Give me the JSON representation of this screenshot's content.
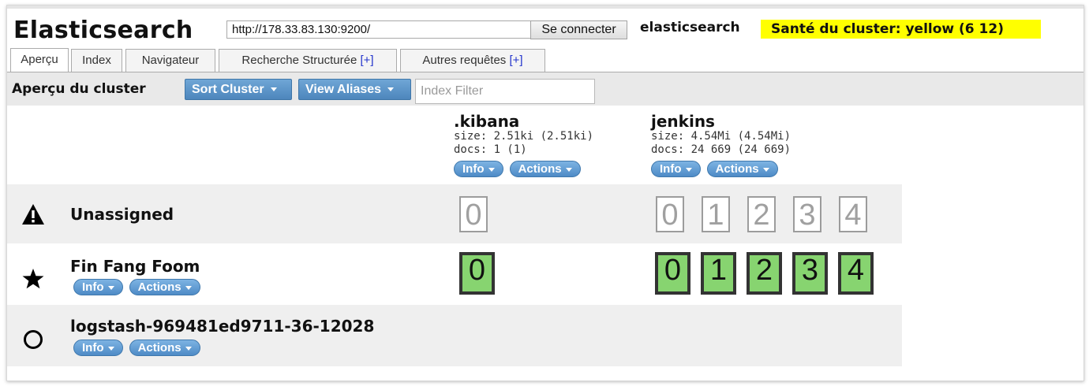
{
  "app": {
    "title": "Elasticsearch",
    "url_value": "http://178.33.83.130:9200/",
    "connect_label": "Se connecter",
    "cluster_name": "elasticsearch",
    "health_label": "Santé du cluster: yellow (6 12)",
    "health_color": "#ffff00"
  },
  "tabs": [
    {
      "label": "Aperçu",
      "plus": ""
    },
    {
      "label": "Index",
      "plus": ""
    },
    {
      "label": "Navigateur",
      "plus": ""
    },
    {
      "label": "Recherche Structurée",
      "plus": "[+]"
    },
    {
      "label": "Autres requêtes",
      "plus": "[+]"
    }
  ],
  "toolbar": {
    "title": "Aperçu du cluster",
    "sort_label": "Sort Cluster",
    "aliases_label": "View Aliases",
    "filter_placeholder": "Index Filter"
  },
  "indices": [
    {
      "name": ".kibana",
      "size": "size: 2.51ki (2.51ki)",
      "docs": "docs: 1 (1)",
      "info": "Info",
      "actions": "Actions"
    },
    {
      "name": "jenkins",
      "size": "size: 4.54Mi (4.54Mi)",
      "docs": "docs: 24 669 (24 669)",
      "info": "Info",
      "actions": "Actions"
    }
  ],
  "nodes": [
    {
      "name": "Unassigned",
      "icon": "warning-icon",
      "kibana_shards": [
        "0"
      ],
      "jenkins_shards": [
        "0",
        "1",
        "2",
        "3",
        "4"
      ],
      "state": "unassigned"
    },
    {
      "name": "Fin Fang Foom",
      "icon": "star-icon",
      "info": "Info",
      "actions": "Actions",
      "kibana_shards": [
        "0"
      ],
      "jenkins_shards": [
        "0",
        "1",
        "2",
        "3",
        "4"
      ],
      "state": "started"
    },
    {
      "name": "logstash-969481ed9711-36-12028",
      "icon": "circle-icon",
      "info": "Info",
      "actions": "Actions",
      "kibana_shards": [],
      "jenkins_shards": []
    }
  ],
  "colors": {
    "shard_started": "#87d470",
    "button_blue": "#4e8bc6"
  }
}
